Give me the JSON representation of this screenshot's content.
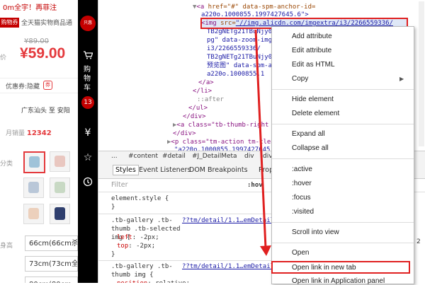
{
  "shop": {
    "title_fragment": "0m全宇！再菲注",
    "promo_badge": "购物券",
    "promo_text": "全天猫实物商品通",
    "original_price": "¥89.00",
    "price_label": "价",
    "price": "¥59.00",
    "coupon_text": "优惠券:隐藏",
    "coupon_icon_label": "券",
    "shipping": "广东汕头  至  安阳",
    "sales_label": "月销量",
    "sales_value": "12342",
    "category_label": "分类",
    "size_label": "身高",
    "size_options": [
      "66cm(66cm杀",
      "73cm(73cm全",
      "80cm(80cm"
    ]
  },
  "toolbar": {
    "logo_text": "只惠",
    "cart_label": "购物车",
    "cart_count": "13",
    "cart_icon": "cart-icon",
    "icons": [
      "yen-icon",
      "star-icon",
      "history-icon"
    ]
  },
  "devtools": {
    "elements": {
      "line1": {
        "tag_open": "<a",
        "attrs": " href=\"#\" data-spm-anchor-id=",
        "value": ""
      },
      "line2": "a220o.1000855.1997427645.6\">",
      "img_src_attr": "src=",
      "img_src_value": "\"//img.alicdn.com/imgextra/i3/2266559336/",
      "line4": "TB2gNETg21TBuNjy0",
      "line5": "pg\" data-zoom-img",
      "line6": "i3/2266559336/",
      "line7": "TB2gNETg21TBuNjy0",
      "line8": "预览图\" data-spm-a",
      "line9": "a220o.1000855.1",
      "close_a": "</a>",
      "close_li": "</li>",
      "after": "::after",
      "close_ul": "</ul>",
      "close_div": "</div>",
      "thumb_right": "<a class=\"tb-thumb-right",
      "close_div2": "</div>",
      "p_line": "<p class=\"tm-action tm-clea",
      "p_line2": "\"a220o.1000855.1997427645.1"
    },
    "breadcrumbs": [
      "...",
      "#content",
      "#detail",
      "#J_DetailMeta",
      "div",
      "div"
    ],
    "tabs": [
      "Styles",
      "Event Listeners",
      "DOM Breakpoints",
      "Propert"
    ],
    "filter_placeholder": "Filter",
    "filter_hint": ":hov",
    "rules": {
      "element_style": "element.style {",
      "close_brace": "}",
      "rule1_selector": ".tb-gallery .tb-thumb .tb-selected img {",
      "rule1_source": "??tm/detail/1.1…emDetail",
      "rule1_props": [
        [
          "left",
          "-2px"
        ],
        [
          "top",
          "-2px"
        ]
      ],
      "rule2_selector": ".tb-gallery .tb-thumb img {",
      "rule2_source": "??tm/detail/1.1…emDetail",
      "rule2_props": [
        [
          "position",
          "relative"
        ]
      ]
    }
  },
  "context_menu": {
    "items": [
      "Add attribute",
      "Edit attribute",
      "Edit as HTML",
      "Copy",
      "Hide element",
      "Delete element",
      "Expand all",
      "Collapse all",
      ":active",
      ":hover",
      ":focus",
      ":visited",
      "Scroll into view",
      "Open",
      "Open link in new tab",
      "Open link in Application panel"
    ],
    "copy_arrow": "▶",
    "side_number": "2"
  },
  "colors": {
    "accent": "#e4393c",
    "annotation": "#e02020",
    "toolbar": "#000000"
  }
}
